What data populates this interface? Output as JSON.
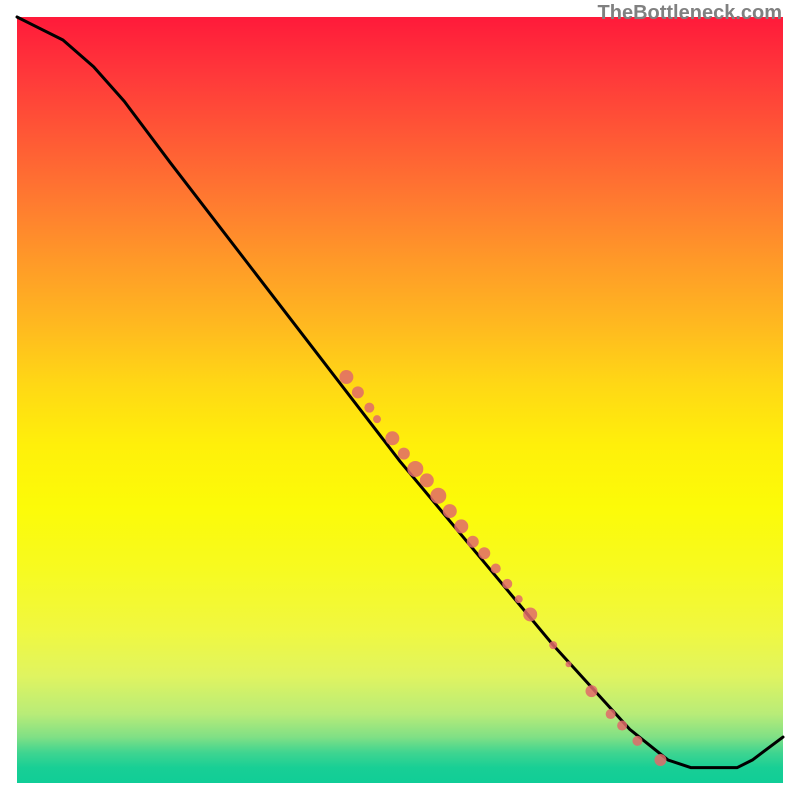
{
  "attribution": "TheBottleneck.com",
  "chart_data": {
    "type": "line",
    "title": "",
    "xlabel": "",
    "ylabel": "",
    "xlim": [
      0,
      100
    ],
    "ylim": [
      0,
      100
    ],
    "curve": [
      {
        "x": 0,
        "y": 100
      },
      {
        "x": 2,
        "y": 99
      },
      {
        "x": 6,
        "y": 97
      },
      {
        "x": 10,
        "y": 93.5
      },
      {
        "x": 14,
        "y": 89
      },
      {
        "x": 20,
        "y": 81
      },
      {
        "x": 30,
        "y": 68
      },
      {
        "x": 40,
        "y": 55
      },
      {
        "x": 50,
        "y": 42
      },
      {
        "x": 60,
        "y": 30
      },
      {
        "x": 70,
        "y": 18
      },
      {
        "x": 80,
        "y": 7
      },
      {
        "x": 85,
        "y": 3
      },
      {
        "x": 88,
        "y": 2
      },
      {
        "x": 94,
        "y": 2
      },
      {
        "x": 96,
        "y": 3
      },
      {
        "x": 100,
        "y": 6
      }
    ],
    "scatter_points": [
      {
        "x": 43,
        "y": 53,
        "r": 7
      },
      {
        "x": 44.5,
        "y": 51,
        "r": 6
      },
      {
        "x": 46,
        "y": 49,
        "r": 5
      },
      {
        "x": 47,
        "y": 47.5,
        "r": 4
      },
      {
        "x": 49,
        "y": 45,
        "r": 7
      },
      {
        "x": 50.5,
        "y": 43,
        "r": 6
      },
      {
        "x": 52,
        "y": 41,
        "r": 8
      },
      {
        "x": 53.5,
        "y": 39.5,
        "r": 7
      },
      {
        "x": 55,
        "y": 37.5,
        "r": 8
      },
      {
        "x": 56.5,
        "y": 35.5,
        "r": 7
      },
      {
        "x": 58,
        "y": 33.5,
        "r": 7
      },
      {
        "x": 59.5,
        "y": 31.5,
        "r": 6
      },
      {
        "x": 61,
        "y": 30,
        "r": 6
      },
      {
        "x": 62.5,
        "y": 28,
        "r": 5
      },
      {
        "x": 64,
        "y": 26,
        "r": 5
      },
      {
        "x": 65.5,
        "y": 24,
        "r": 4
      },
      {
        "x": 67,
        "y": 22,
        "r": 7
      },
      {
        "x": 70,
        "y": 18,
        "r": 4
      },
      {
        "x": 72,
        "y": 15.5,
        "r": 3
      },
      {
        "x": 75,
        "y": 12,
        "r": 6
      },
      {
        "x": 77.5,
        "y": 9,
        "r": 5
      },
      {
        "x": 79,
        "y": 7.5,
        "r": 5
      },
      {
        "x": 81,
        "y": 5.5,
        "r": 5
      },
      {
        "x": 84,
        "y": 3,
        "r": 6
      }
    ],
    "colors": {
      "curve": "#000000",
      "point_fill": "#e06a6a",
      "point_stroke": "#c85555"
    }
  }
}
